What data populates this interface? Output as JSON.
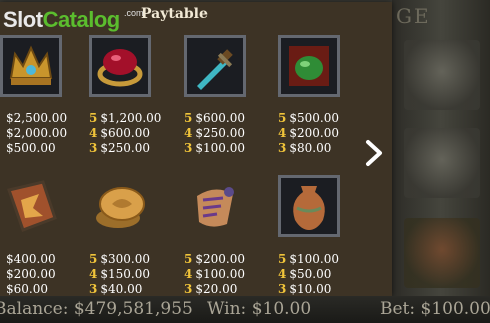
{
  "watermark": {
    "brand_part1": "Slot",
    "brand_part2": "Catalog",
    "brand_suffix": ".com"
  },
  "paytable": {
    "title": "Paytable",
    "symbols": [
      {
        "name": "crown",
        "lines": [
          {
            "n": "",
            "v": "$2,500.00"
          },
          {
            "n": "",
            "v": "$2,000.00"
          },
          {
            "n": "",
            "v": "$500.00"
          }
        ]
      },
      {
        "name": "ring",
        "lines": [
          {
            "n": "5",
            "v": "$1,200.00"
          },
          {
            "n": "4",
            "v": "$600.00"
          },
          {
            "n": "3",
            "v": "$250.00"
          }
        ]
      },
      {
        "name": "dagger",
        "lines": [
          {
            "n": "5",
            "v": "$600.00"
          },
          {
            "n": "4",
            "v": "$250.00"
          },
          {
            "n": "3",
            "v": "$100.00"
          }
        ]
      },
      {
        "name": "potion",
        "lines": [
          {
            "n": "5",
            "v": "$500.00"
          },
          {
            "n": "4",
            "v": "$200.00"
          },
          {
            "n": "3",
            "v": "$80.00"
          }
        ]
      },
      {
        "name": "shield",
        "lines": [
          {
            "n": "",
            "v": "$400.00"
          },
          {
            "n": "",
            "v": "$200.00"
          },
          {
            "n": "",
            "v": "$60.00"
          }
        ]
      },
      {
        "name": "coins",
        "lines": [
          {
            "n": "5",
            "v": "$300.00"
          },
          {
            "n": "4",
            "v": "$150.00"
          },
          {
            "n": "3",
            "v": "$40.00"
          }
        ]
      },
      {
        "name": "scroll",
        "lines": [
          {
            "n": "5",
            "v": "$200.00"
          },
          {
            "n": "4",
            "v": "$100.00"
          },
          {
            "n": "3",
            "v": "$20.00"
          }
        ]
      },
      {
        "name": "vase",
        "lines": [
          {
            "n": "5",
            "v": "$100.00"
          },
          {
            "n": "4",
            "v": "$50.00"
          },
          {
            "n": "3",
            "v": "$10.00"
          }
        ]
      }
    ]
  },
  "background_title_fragment": "GE",
  "status": {
    "balance": "Balance: $479,581,955",
    "win": "Win: $10.00",
    "bet": "Bet: $100.00"
  },
  "colors": {
    "panel": "#3d3325",
    "multiplier": "#f0c43a",
    "frame": "#646870",
    "brand_green": "#5bbd2e"
  },
  "icons": {
    "next": "chevron-right-icon"
  }
}
